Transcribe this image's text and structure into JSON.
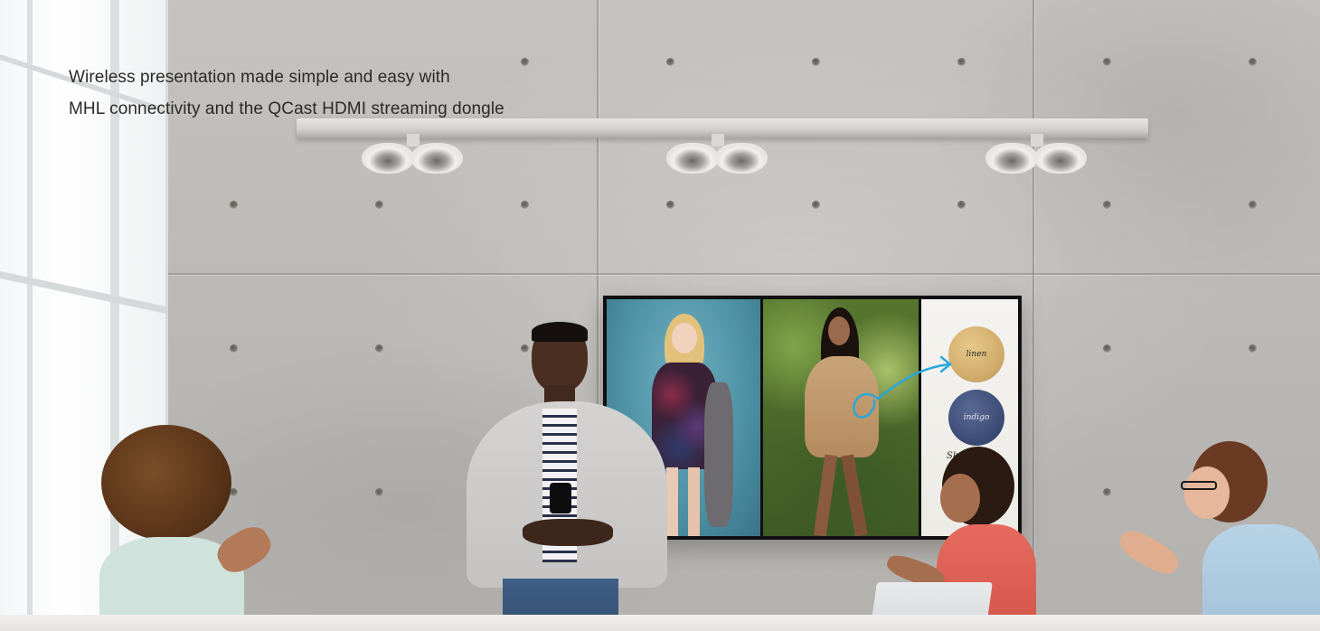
{
  "headline": {
    "line1": "Wireless presentation made simple and easy with",
    "line2": "MHL connectivity and the QCast HDMI streaming dongle"
  },
  "screen_content": {
    "swatch_1": "linen",
    "swatch_2": "indigo",
    "swatch_3": "Sketch"
  },
  "colors": {
    "headline_text": "#2b2a28",
    "wall": "#bcbab6",
    "annotation_arrow": "#2aa7d8"
  }
}
